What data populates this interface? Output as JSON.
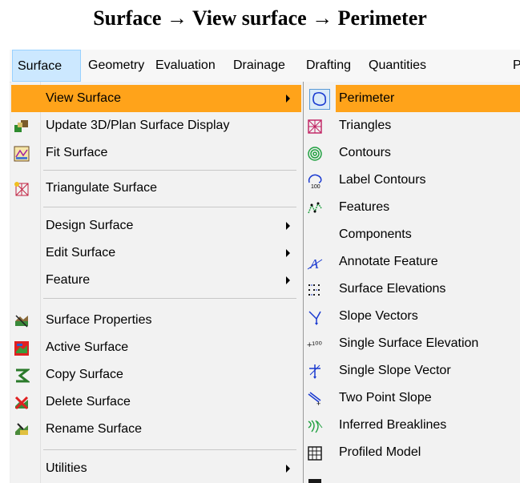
{
  "caption": "Surface → View surface → Perimeter",
  "menubar": {
    "items": [
      "Surface",
      "Geometry",
      "Evaluation",
      "Drainage",
      "Drafting",
      "Quantities",
      "P"
    ]
  },
  "surface_menu": {
    "items": [
      {
        "label": "View Surface",
        "icon": "none",
        "submenu": true,
        "highlighted": true
      },
      {
        "label": "Update 3D/Plan Surface Display",
        "icon": "update-display-icon"
      },
      {
        "label": "Fit Surface",
        "icon": "fit-surface-icon"
      },
      {
        "label": "Triangulate Surface",
        "icon": "triangulate-icon"
      },
      {
        "label": "Design Surface",
        "icon": "none",
        "submenu": true
      },
      {
        "label": "Edit Surface",
        "icon": "none",
        "submenu": true
      },
      {
        "label": "Feature",
        "icon": "none",
        "submenu": true
      },
      {
        "label": "Surface Properties",
        "icon": "surface-properties-icon"
      },
      {
        "label": "Active Surface",
        "icon": "active-surface-icon"
      },
      {
        "label": "Copy Surface",
        "icon": "copy-surface-icon"
      },
      {
        "label": "Delete Surface",
        "icon": "delete-surface-icon"
      },
      {
        "label": "Rename Surface",
        "icon": "rename-surface-icon"
      },
      {
        "label": "Utilities",
        "icon": "none",
        "submenu": true
      }
    ]
  },
  "view_surface_submenu": {
    "items": [
      {
        "label": "Perimeter",
        "icon": "perimeter-icon",
        "highlighted": true
      },
      {
        "label": "Triangles",
        "icon": "triangles-icon"
      },
      {
        "label": "Contours",
        "icon": "contours-icon"
      },
      {
        "label": "Label Contours",
        "icon": "label-contours-icon",
        "icon_text": "100"
      },
      {
        "label": "Features",
        "icon": "features-icon"
      },
      {
        "label": "Components",
        "icon": "none"
      },
      {
        "label": "Annotate Feature",
        "icon": "annotate-feature-icon"
      },
      {
        "label": "Surface Elevations",
        "icon": "surface-elevations-icon"
      },
      {
        "label": "Slope Vectors",
        "icon": "slope-vectors-icon"
      },
      {
        "label": "Single Surface Elevation",
        "icon": "single-surface-elevation-icon",
        "icon_text": "+¹⁰⁰"
      },
      {
        "label": "Single Slope Vector",
        "icon": "single-slope-vector-icon"
      },
      {
        "label": "Two Point Slope",
        "icon": "two-point-slope-icon"
      },
      {
        "label": "Inferred Breaklines",
        "icon": "inferred-breaklines-icon"
      },
      {
        "label": "Profiled Model",
        "icon": "profiled-model-icon"
      }
    ]
  },
  "colors": {
    "highlight": "#ffa31a",
    "menu_bg": "#f2f2f2",
    "active_menubar": "#cce8ff"
  }
}
